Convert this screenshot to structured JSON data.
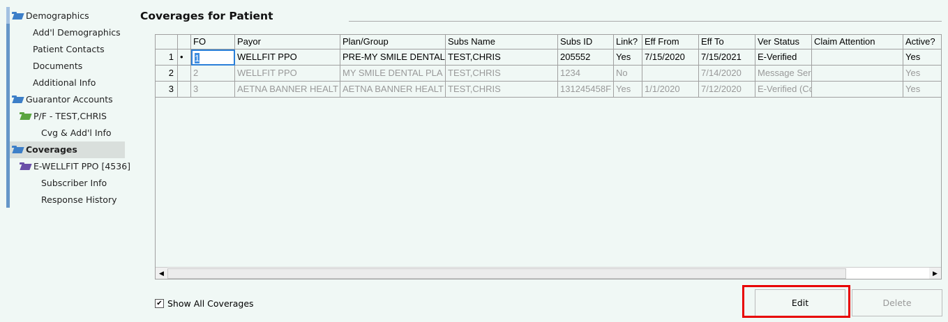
{
  "sidebar": {
    "items": [
      {
        "label": "Demographics",
        "icon": "folder-blue"
      },
      {
        "label": "Add'l Demographics"
      },
      {
        "label": "Patient Contacts"
      },
      {
        "label": "Documents"
      },
      {
        "label": "Additional Info"
      },
      {
        "label": "Guarantor Accounts",
        "icon": "folder-blue"
      },
      {
        "label": "P/F - TEST,CHRIS",
        "icon": "folder-green"
      },
      {
        "label": "Cvg & Add'l Info"
      },
      {
        "label": "Coverages",
        "icon": "folder-blue",
        "selected": true
      },
      {
        "label": "E-WELLFIT PPO [4536]",
        "icon": "folder-purple"
      },
      {
        "label": "Subscriber Info"
      },
      {
        "label": "Response History"
      }
    ]
  },
  "page": {
    "title": "Coverages for Patient"
  },
  "grid": {
    "columns": [
      "",
      "",
      "FO",
      "Payor",
      "Plan/Group",
      "Subs Name",
      "Subs ID",
      "Link?",
      "Eff From",
      "Eff To",
      "Ver Status",
      "Claim Attention",
      "Active?"
    ],
    "rows": [
      [
        "1",
        "•",
        "1",
        "WELLFIT PPO",
        "PRE-MY SMILE DENTAL",
        "TEST,CHRIS",
        "205552",
        "Yes",
        "7/15/2020",
        "7/15/2021",
        "E-Verified",
        "",
        "Yes"
      ],
      [
        "2",
        "",
        "2",
        "WELLFIT PPO",
        "MY SMILE DENTAL PLA",
        "TEST,CHRIS",
        "1234",
        "No",
        "",
        "7/14/2020",
        "Message Ser",
        "",
        "Yes"
      ],
      [
        "3",
        "",
        "3",
        "AETNA BANNER HEALT",
        "AETNA BANNER HEALT",
        "TEST,CHRIS",
        "131245458F",
        "Yes",
        "1/1/2020",
        "7/12/2020",
        "E-Verified (Co",
        "",
        "Yes"
      ]
    ]
  },
  "footer": {
    "show_all_label": "Show All Coverages",
    "show_all_checked": true,
    "edit_label": "Edit",
    "delete_label": "Delete"
  },
  "colors": {
    "highlight": "#e80000",
    "accent": "#2a7fd8"
  }
}
